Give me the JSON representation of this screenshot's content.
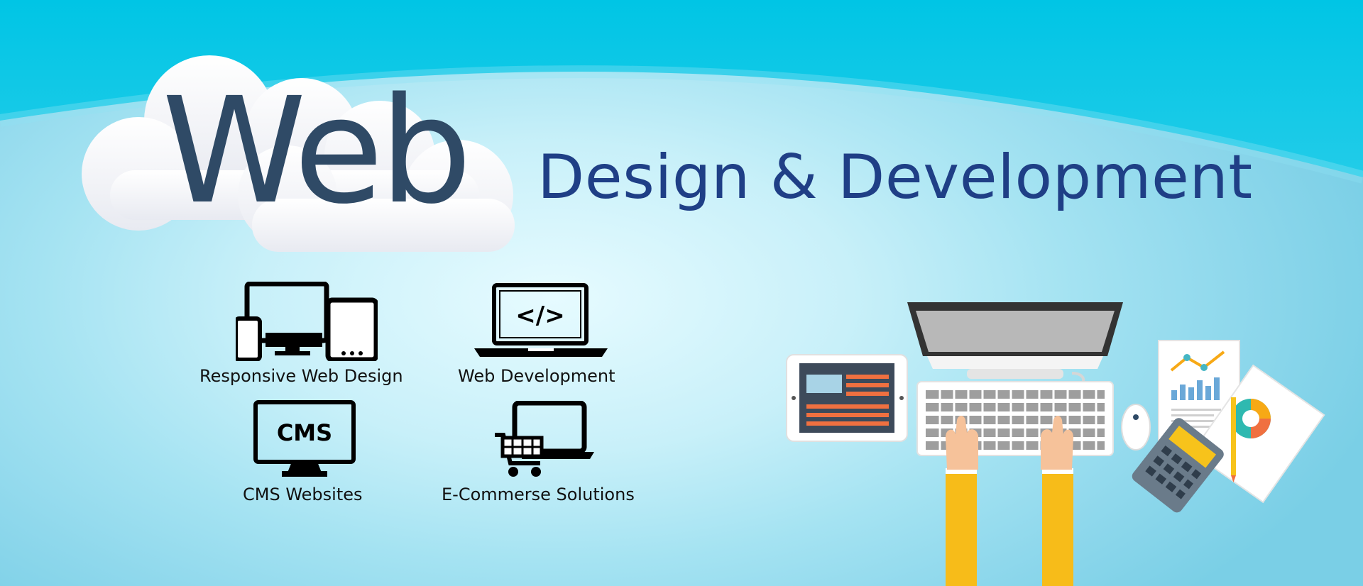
{
  "banner": {
    "logo_word": "Web",
    "headline": "Design & Development",
    "colors": {
      "sky": "#00c8e6",
      "headline": "#1f3f86",
      "logo_word": "#2f4a66"
    }
  },
  "services": [
    {
      "label": "Responsive Web Design",
      "icon": "responsive-devices-icon"
    },
    {
      "label": "Web Development",
      "icon": "code-laptop-icon"
    },
    {
      "label": "CMS Websites",
      "icon": "cms-monitor-icon"
    },
    {
      "label": "E-Commerse Solutions",
      "icon": "shopping-cart-laptop-icon"
    }
  ],
  "cms_icon_text": "CMS",
  "code_icon_text": "</>",
  "illustration": {
    "icon": "developer-workspace-illustration"
  }
}
